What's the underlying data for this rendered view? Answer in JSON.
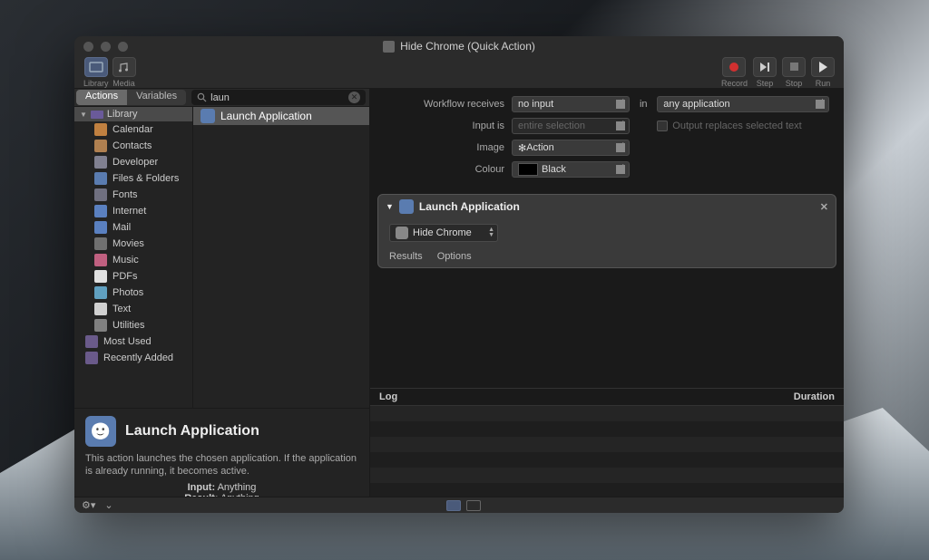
{
  "window": {
    "title": "Hide Chrome (Quick Action)"
  },
  "toolbar": {
    "left": [
      {
        "name": "library-button",
        "label": "Library",
        "active": true
      },
      {
        "name": "media-button",
        "label": "Media",
        "active": false
      }
    ],
    "right": [
      {
        "name": "record-button",
        "label": "Record",
        "icon": "record-icon"
      },
      {
        "name": "step-button",
        "label": "Step",
        "icon": "step-icon"
      },
      {
        "name": "stop-button",
        "label": "Stop",
        "icon": "stop-icon"
      },
      {
        "name": "run-button",
        "label": "Run",
        "icon": "play-icon"
      }
    ]
  },
  "sidebar": {
    "tabs": [
      {
        "label": "Actions",
        "active": true
      },
      {
        "label": "Variables",
        "active": false
      }
    ],
    "search": {
      "value": "laun"
    },
    "library": {
      "header": "Library",
      "categories": [
        {
          "label": "Calendar",
          "color": "#c08040"
        },
        {
          "label": "Contacts",
          "color": "#b08050"
        },
        {
          "label": "Developer",
          "color": "#808090"
        },
        {
          "label": "Files & Folders",
          "color": "#5a7cb0"
        },
        {
          "label": "Fonts",
          "color": "#707080"
        },
        {
          "label": "Internet",
          "color": "#5a80c0"
        },
        {
          "label": "Mail",
          "color": "#5a80c0"
        },
        {
          "label": "Movies",
          "color": "#707070"
        },
        {
          "label": "Music",
          "color": "#c06080"
        },
        {
          "label": "PDFs",
          "color": "#e0e0e0"
        },
        {
          "label": "Photos",
          "color": "#60a0c0"
        },
        {
          "label": "Text",
          "color": "#d0d0d0"
        },
        {
          "label": "Utilities",
          "color": "#808080"
        }
      ],
      "smart": [
        {
          "label": "Most Used"
        },
        {
          "label": "Recently Added"
        }
      ]
    },
    "results": [
      {
        "label": "Launch Application"
      }
    ],
    "info": {
      "title": "Launch Application",
      "description": "This action launches the chosen application. If the application is already running, it becomes active.",
      "input_label": "Input:",
      "input_value": "Anything",
      "result_label": "Result:",
      "result_value": "Anything"
    }
  },
  "workflowHeader": {
    "receives_label": "Workflow receives",
    "receives_value": "no input",
    "in_label": "in",
    "in_value": "any application",
    "inputis_label": "Input is",
    "inputis_value": "entire selection",
    "replace_label": "Output replaces selected text",
    "image_label": "Image",
    "image_value": "Action",
    "colour_label": "Colour",
    "colour_value": "Black"
  },
  "action": {
    "title": "Launch Application",
    "selected_app": "Hide Chrome",
    "tabs": [
      {
        "label": "Results"
      },
      {
        "label": "Options"
      }
    ]
  },
  "log": {
    "col1": "Log",
    "col2": "Duration"
  }
}
